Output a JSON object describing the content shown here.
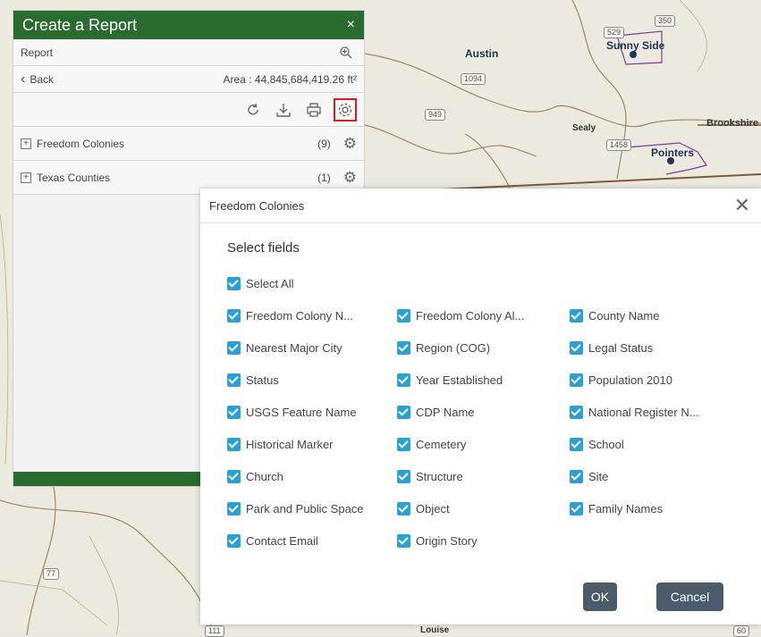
{
  "map": {
    "labels": [
      "Austin",
      "Sunny Side",
      "Sealy",
      "Brookshire",
      "Pointers",
      "Louise"
    ],
    "shields": [
      "350",
      "1094",
      "949",
      "1458",
      "529",
      "77",
      "111",
      "60"
    ]
  },
  "panel": {
    "title": "Create a Report",
    "close_glyph": "×",
    "report_label": "Report",
    "back_label": "Back",
    "area_text": "Area : 44,845,684,419.26 ft²",
    "layers": [
      {
        "name": "Freedom Colonies",
        "count": "(9)"
      },
      {
        "name": "Texas Counties",
        "count": "(1)"
      }
    ]
  },
  "dialog": {
    "title": "Freedom Colonies",
    "close_glyph": "✕",
    "select_fields_heading": "Select fields",
    "select_all_label": "Select All",
    "fields": [
      [
        "Freedom Colony N...",
        "Freedom Colony Al...",
        "County Name"
      ],
      [
        "Nearest Major City",
        "Region (COG)",
        "Legal Status"
      ],
      [
        "Status",
        "Year Established",
        "Population 2010"
      ],
      [
        "USGS Feature Name",
        "CDP Name",
        "National Register N..."
      ],
      [
        "Historical Marker",
        "Cemetery",
        "School"
      ],
      [
        "Church",
        "Structure",
        "Site"
      ],
      [
        "Park and Public Space",
        "Object",
        "Family Names"
      ],
      [
        "Contact Email",
        "Origin Story",
        ""
      ]
    ],
    "ok_label": "OK",
    "cancel_label": "Cancel"
  },
  "colors": {
    "header_green": "#2b6b2f",
    "checkbox_blue": "#2aa0d6",
    "button_gray": "#4c5b6b",
    "highlight_red": "#e0191a"
  }
}
